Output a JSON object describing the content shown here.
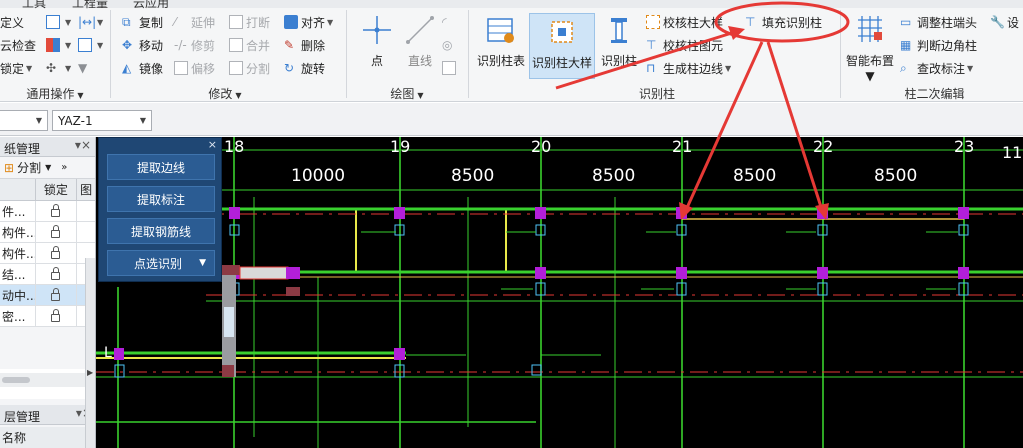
{
  "ribbon": {
    "tabs_fragments": [
      "工具",
      "工程量",
      "云应用"
    ],
    "groups": {
      "general": {
        "label": "通用操作",
        "items": [
          "定义",
          "云检查",
          "锁定"
        ]
      },
      "modify": {
        "label": "修改",
        "items": [
          {
            "label": "复制",
            "enabled": true
          },
          {
            "label": "延伸",
            "enabled": false
          },
          {
            "label": "打断",
            "enabled": false
          },
          {
            "label": "对齐",
            "enabled": true
          },
          {
            "label": "移动",
            "enabled": true
          },
          {
            "label": "修剪",
            "enabled": false
          },
          {
            "label": "合并",
            "enabled": false
          },
          {
            "label": "删除",
            "enabled": true
          },
          {
            "label": "镜像",
            "enabled": true
          },
          {
            "label": "偏移",
            "enabled": false
          },
          {
            "label": "分割",
            "enabled": false
          },
          {
            "label": "旋转",
            "enabled": true
          }
        ]
      },
      "draw": {
        "label": "绘图",
        "items": [
          "点",
          "直线"
        ]
      },
      "recognize_column": {
        "label": "识别柱",
        "items": [
          "识别柱表",
          "识别柱大样",
          "识别柱",
          "校核柱大样",
          "校核柱图元",
          "生成柱边线",
          "填充识别柱"
        ]
      },
      "column_edit": {
        "label": "柱二次编辑",
        "items": [
          "智能布置",
          "调整柱端头",
          "判断边角柱",
          "查改标注",
          "设"
        ]
      }
    }
  },
  "toolbar2": {
    "combo2_value": "YAZ-1"
  },
  "left_panel": {
    "title": "纸管理",
    "split_label": "分割",
    "col_lock": "锁定",
    "col_extra": "图",
    "rows": [
      "件...",
      "构件...",
      "构件...",
      "结...",
      "动中...",
      "密..."
    ],
    "layer_title": "层管理",
    "layer_col": "名称"
  },
  "float_panel": {
    "buttons": [
      "提取边线",
      "提取标注",
      "提取钢筋线",
      "点选识别"
    ]
  },
  "drawing": {
    "axes": [
      "18",
      "19",
      "20",
      "21",
      "22",
      "23",
      "11"
    ],
    "spans": [
      "10000",
      "8500",
      "8500",
      "8500",
      "8500"
    ],
    "left_marker": "L"
  },
  "colors": {
    "accent": "#3b7fd1",
    "annotation_red": "#e53935",
    "canvas_bg": "#000000",
    "axis_green": "#39d12e",
    "column_magenta": "#b21fd9",
    "float_panel": "#1f4774"
  }
}
